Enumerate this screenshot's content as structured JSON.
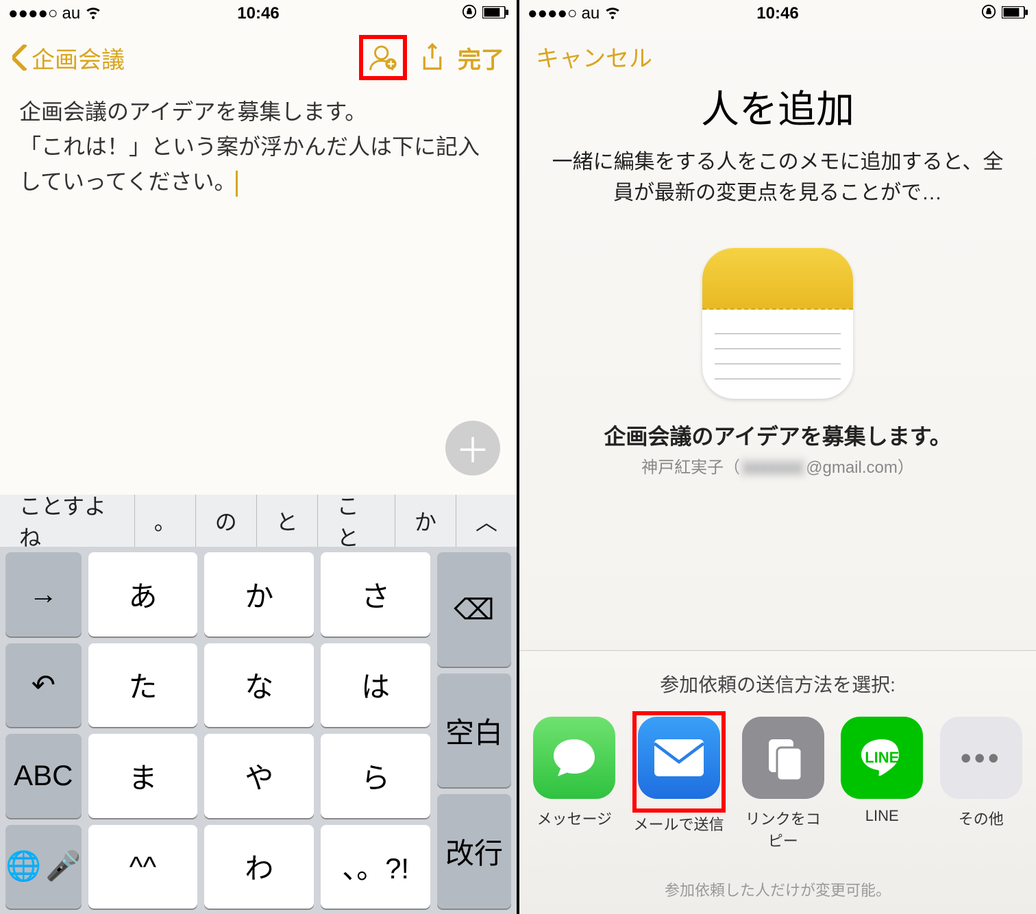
{
  "statusbar": {
    "carrier": "au",
    "time": "10:46"
  },
  "left": {
    "back_label": "企画会議",
    "done_label": "完了",
    "note_text": "企画会議のアイデアを募集します。\n「これは！」という案が浮かんだ人は下に記入していってください。",
    "suggestions": [
      "ことすよね",
      "。",
      "の",
      "と",
      "こと",
      "か"
    ],
    "keys": {
      "row1": [
        "あ",
        "か",
        "さ"
      ],
      "row2": [
        "た",
        "な",
        "は"
      ],
      "row3": [
        "ま",
        "や",
        "ら"
      ],
      "row4": [
        "^^",
        "わ",
        "、。?!"
      ],
      "side_left": [
        "→",
        "↶",
        "ABC"
      ],
      "side_right": [
        "⌫",
        "空白",
        "改行"
      ]
    }
  },
  "right": {
    "cancel_label": "キャンセル",
    "title": "人を追加",
    "subtitle": "一緒に編集をする人をこのメモに追加すると、全員が最新の変更点を見ることがで…",
    "note_title": "企画会議のアイデアを募集します。",
    "owner_name": "神戸紅実子",
    "owner_email_suffix": "@gmail.com",
    "share_label": "参加依頼の送信方法を選択:",
    "share_items": [
      {
        "name": "messages",
        "label": "メッセージ"
      },
      {
        "name": "mail",
        "label": "メールで送信"
      },
      {
        "name": "copy",
        "label": "リンクをコピー"
      },
      {
        "name": "line",
        "label": "LINE"
      },
      {
        "name": "more",
        "label": "その他"
      }
    ],
    "footer": "参加依頼した人だけが変更可能。"
  }
}
